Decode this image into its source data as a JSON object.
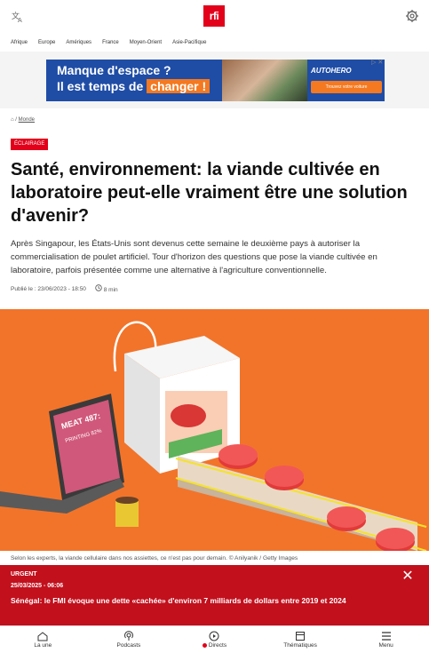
{
  "topbar": {
    "logo_text": "rfi",
    "lang_icon": "translate-icon",
    "settings_icon": "gear-icon"
  },
  "regions": [
    "Afrique",
    "Europe",
    "Amériques",
    "France",
    "Moyen-Orient",
    "Asie-Pacifique"
  ],
  "ad": {
    "line1": "Manque d'espace ?",
    "line2_prefix": "Il est temps de",
    "line2_highlight": "changer !",
    "brand": "AUTOHERO",
    "cta": "Trouvez votre voiture"
  },
  "breadcrumb": {
    "section": "Monde"
  },
  "article": {
    "tag": "Éclairage",
    "title": "Santé, environnement: la viande cultivée en laboratoire peut-elle vraiment être une solution d'avenir?",
    "lede": "Après Singapour, les États-Unis sont devenus cette semaine le deuxième pays à autoriser la commercialisation de poulet artificiel. Tour d'horizon des questions que pose la viande cultivée en laboratoire, parfois présentée comme une alternative à l'agriculture conventionnelle.",
    "published": "Publié le : 23/06/2023 - 18:50",
    "read_time": "8 min",
    "image_screen_line1": "MEAT 487:",
    "image_screen_line2": "PRINTING 82%",
    "caption": "Selon les experts, la viande cellulaire dans nos assiettes, ce n'est pas pour demain. © Anilyanik / Getty Images"
  },
  "alert": {
    "kicker": "URGENT",
    "date": "25/03/2025 - 06:06",
    "text": "Sénégal: le FMI évoque une dette «cachée» d'environ 7 milliards de dollars entre 2019 et 2024"
  },
  "nav": [
    {
      "label": "La une",
      "icon": "home-icon"
    },
    {
      "label": "Podcasts",
      "icon": "podcast-icon"
    },
    {
      "label": "Directs",
      "icon": "play-icon"
    },
    {
      "label": "Thématiques",
      "icon": "themes-icon"
    },
    {
      "label": "Menu",
      "icon": "menu-icon"
    }
  ],
  "colors": {
    "brand_red": "#e2001a",
    "alert_red": "#c2101d",
    "hero_orange": "#f2742a",
    "ad_blue": "#1f4da6",
    "ad_orange": "#f47920"
  }
}
